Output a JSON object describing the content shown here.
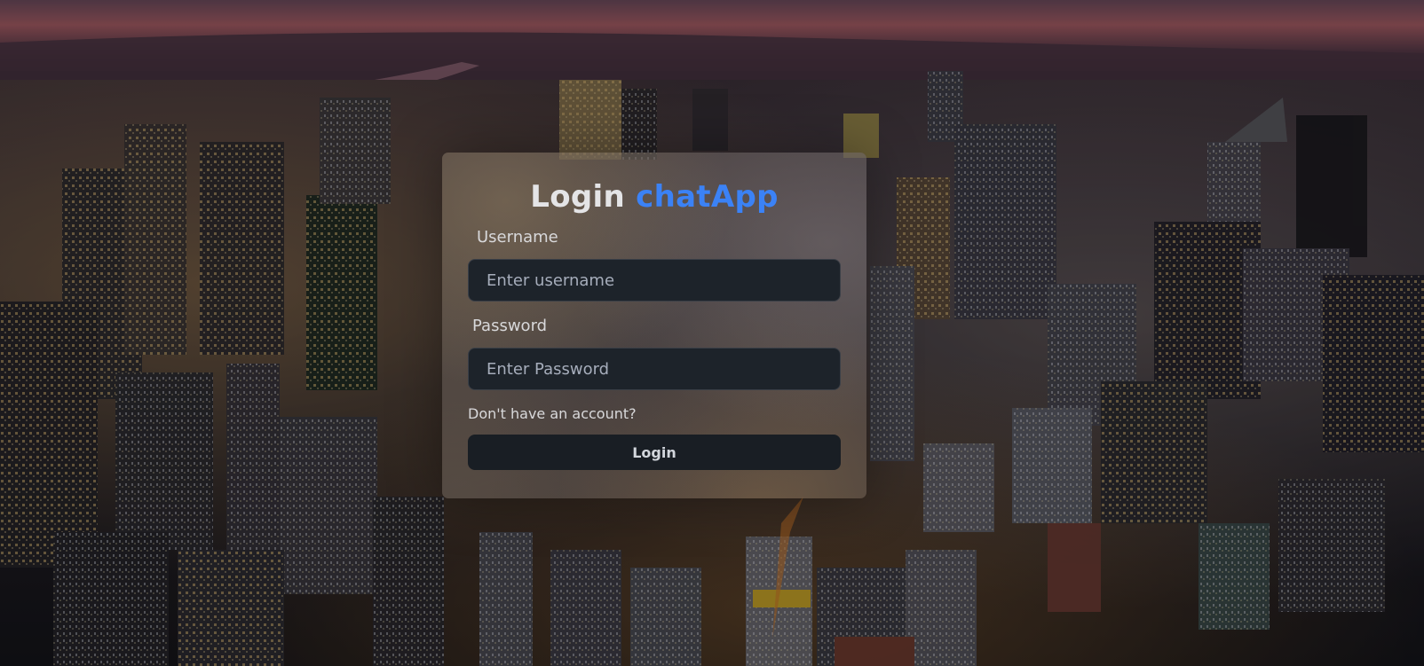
{
  "app": {
    "title_prefix": "Login",
    "title_brand": "chatApp",
    "brand_color": "#3b82f6"
  },
  "form": {
    "username": {
      "label": "Username",
      "placeholder": "Enter username",
      "value": ""
    },
    "password": {
      "label": "Password",
      "placeholder": "Enter Password",
      "value": ""
    },
    "signup_link": "Don't have an account?",
    "submit_label": "Login"
  },
  "background": {
    "subject": "city-skyline-at-dusk"
  }
}
